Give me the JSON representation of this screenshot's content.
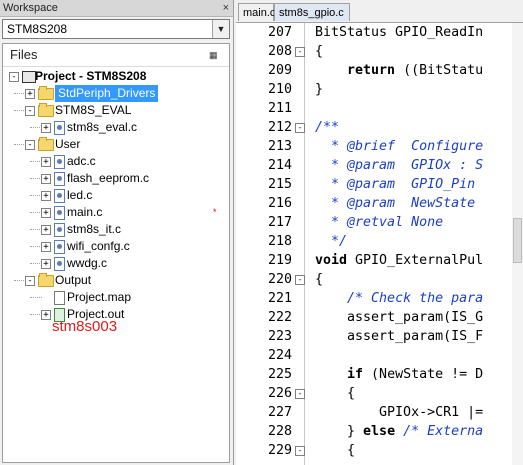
{
  "workspace": {
    "title": "Workspace",
    "close_glyph": "×",
    "config_selected": "STM8S208",
    "files_header": "Files",
    "settings_icon": "settings-icon",
    "tree": [
      {
        "label": "Project - STM8S208",
        "level": 0,
        "type": "project",
        "toggle": "-",
        "bold": true,
        "selected": false
      },
      {
        "label": "StdPeriph_Drivers",
        "level": 1,
        "type": "folder",
        "toggle": "+",
        "selected": true
      },
      {
        "label": "STM8S_EVAL",
        "level": 1,
        "type": "folder",
        "toggle": "-",
        "selected": false
      },
      {
        "label": "stm8s_eval.c",
        "level": 2,
        "type": "file",
        "toggle": "+",
        "selected": false
      },
      {
        "label": "User",
        "level": 1,
        "type": "folder",
        "toggle": "-",
        "selected": false
      },
      {
        "label": "adc.c",
        "level": 2,
        "type": "file",
        "toggle": "+",
        "selected": false
      },
      {
        "label": "flash_eeprom.c",
        "level": 2,
        "type": "file",
        "toggle": "+",
        "selected": false
      },
      {
        "label": "led.c",
        "level": 2,
        "type": "file",
        "toggle": "+",
        "selected": false
      },
      {
        "label": "main.c",
        "level": 2,
        "type": "file",
        "toggle": "+",
        "selected": false,
        "modified": "*"
      },
      {
        "label": "stm8s_it.c",
        "level": 2,
        "type": "file",
        "toggle": "+",
        "selected": false
      },
      {
        "label": "wifi_confg.c",
        "level": 2,
        "type": "file",
        "toggle": "+",
        "selected": false
      },
      {
        "label": "wwdg.c",
        "level": 2,
        "type": "file",
        "toggle": "+",
        "selected": false
      },
      {
        "label": "Output",
        "level": 1,
        "type": "folder",
        "toggle": "-",
        "selected": false
      },
      {
        "label": "Project.map",
        "level": 2,
        "type": "map",
        "toggle": "",
        "selected": false
      },
      {
        "label": "Project.out",
        "level": 2,
        "type": "out",
        "toggle": "+",
        "selected": false
      }
    ],
    "annotation": "stm8s003"
  },
  "editor": {
    "tabs": [
      {
        "label": "main.c",
        "active": false
      },
      {
        "label": "stm8s_gpio.c",
        "active": true
      }
    ],
    "lines": [
      {
        "num": "207",
        "fold": "",
        "segments": [
          {
            "t": "BitStatus GPIO_ReadIn",
            "c": "n"
          }
        ]
      },
      {
        "num": "208",
        "fold": "-",
        "segments": [
          {
            "t": "{",
            "c": "n"
          }
        ]
      },
      {
        "num": "209",
        "fold": "",
        "segments": [
          {
            "t": "    ",
            "c": "n"
          },
          {
            "t": "return",
            "c": "k"
          },
          {
            "t": " ((BitStatu",
            "c": "n"
          }
        ]
      },
      {
        "num": "210",
        "fold": "",
        "segments": [
          {
            "t": "}",
            "c": "n"
          }
        ]
      },
      {
        "num": "211",
        "fold": "",
        "segments": []
      },
      {
        "num": "212",
        "fold": "-",
        "segments": [
          {
            "t": "/**",
            "c": "c"
          }
        ]
      },
      {
        "num": "213",
        "fold": "",
        "segments": [
          {
            "t": "  * @brief  Configure",
            "c": "c"
          }
        ]
      },
      {
        "num": "214",
        "fold": "",
        "segments": [
          {
            "t": "  * @param  GPIOx : S",
            "c": "c"
          }
        ]
      },
      {
        "num": "215",
        "fold": "",
        "segments": [
          {
            "t": "  * @param  GPIO_Pin",
            "c": "c"
          }
        ]
      },
      {
        "num": "216",
        "fold": "",
        "segments": [
          {
            "t": "  * @param  NewState",
            "c": "c"
          }
        ]
      },
      {
        "num": "217",
        "fold": "",
        "segments": [
          {
            "t": "  * @retval None",
            "c": "c"
          }
        ]
      },
      {
        "num": "218",
        "fold": "",
        "segments": [
          {
            "t": "  */",
            "c": "c"
          }
        ]
      },
      {
        "num": "219",
        "fold": "",
        "segments": [
          {
            "t": "void",
            "c": "k"
          },
          {
            "t": " GPIO_ExternalPul",
            "c": "n"
          }
        ]
      },
      {
        "num": "220",
        "fold": "-",
        "segments": [
          {
            "t": "{",
            "c": "n"
          }
        ]
      },
      {
        "num": "221",
        "fold": "",
        "segments": [
          {
            "t": "    ",
            "c": "n"
          },
          {
            "t": "/* Check the para",
            "c": "c"
          }
        ]
      },
      {
        "num": "222",
        "fold": "",
        "segments": [
          {
            "t": "    assert_param(IS_G",
            "c": "n"
          }
        ]
      },
      {
        "num": "223",
        "fold": "",
        "segments": [
          {
            "t": "    assert_param(IS_F",
            "c": "n"
          }
        ]
      },
      {
        "num": "224",
        "fold": "",
        "segments": []
      },
      {
        "num": "225",
        "fold": "",
        "segments": [
          {
            "t": "    ",
            "c": "n"
          },
          {
            "t": "if",
            "c": "k"
          },
          {
            "t": " (NewState != D",
            "c": "n"
          }
        ]
      },
      {
        "num": "226",
        "fold": "-",
        "segments": [
          {
            "t": "    {",
            "c": "n"
          }
        ]
      },
      {
        "num": "227",
        "fold": "",
        "segments": [
          {
            "t": "        GPIOx->CR1 |=",
            "c": "n"
          }
        ]
      },
      {
        "num": "228",
        "fold": "",
        "segments": [
          {
            "t": "    } ",
            "c": "n"
          },
          {
            "t": "else",
            "c": "k"
          },
          {
            "t": " ",
            "c": "n"
          },
          {
            "t": "/* Externa",
            "c": "c"
          }
        ]
      },
      {
        "num": "229",
        "fold": "-",
        "segments": [
          {
            "t": "    {",
            "c": "n"
          }
        ]
      }
    ]
  }
}
